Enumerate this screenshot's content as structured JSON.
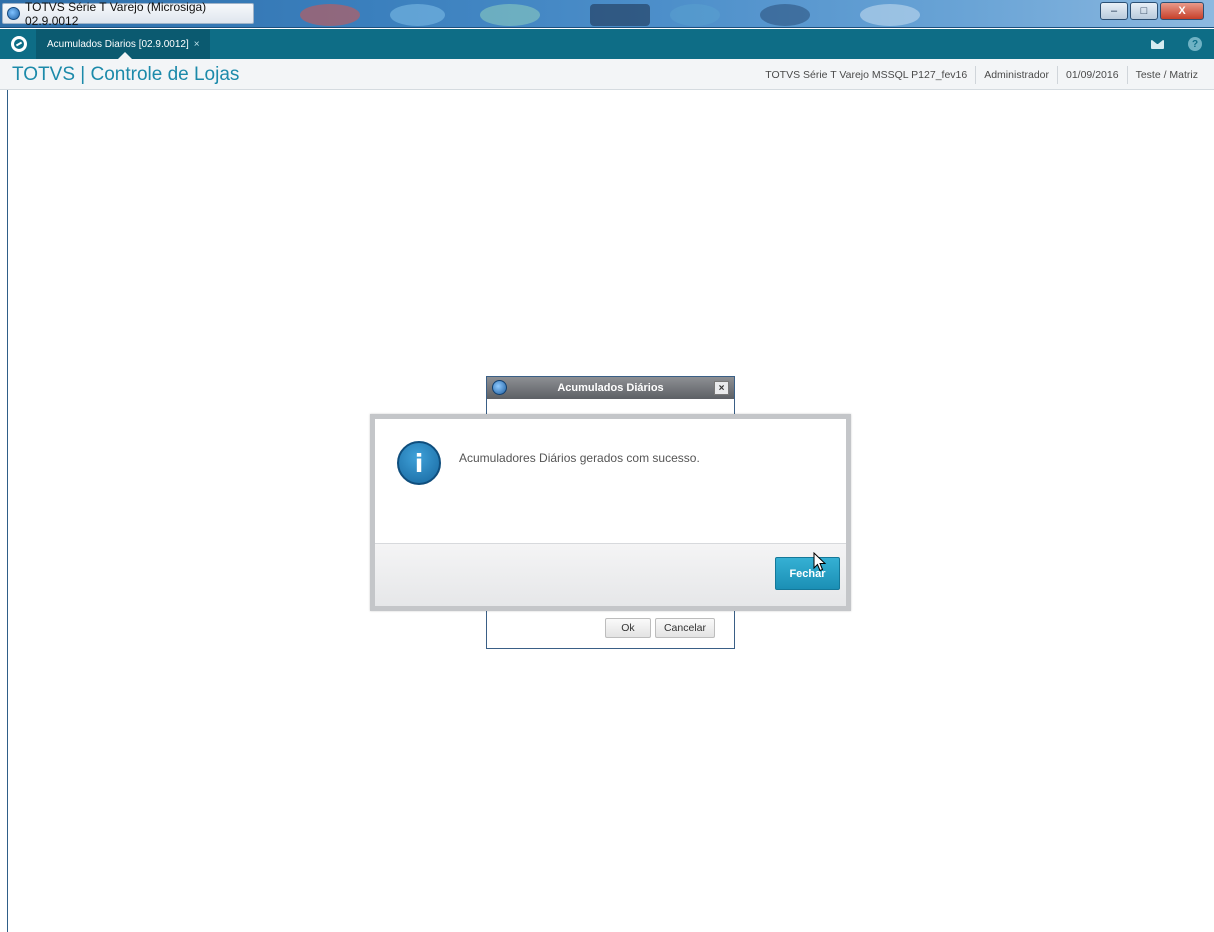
{
  "window": {
    "title": "TOTVS Série T Varejo (Microsiga) 02.9.0012",
    "controls": {
      "minimize": "–",
      "maximize": "□",
      "close": "X"
    }
  },
  "tabbar": {
    "tab_label": "Acumulados Diarios [02.9.0012]",
    "tab_close": "×",
    "help_glyph": "?"
  },
  "header": {
    "app_title": "TOTVS | Controle de Lojas",
    "environment": "TOTVS Série T Varejo MSSQL P127_fev16",
    "user": "Administrador",
    "date": "01/09/2016",
    "branch": "Teste / Matriz"
  },
  "background_dialog": {
    "title": "Acumulados Diários",
    "close_glyph": "×",
    "ok_label": "Ok",
    "cancel_label": "Cancelar"
  },
  "message_dialog": {
    "icon_glyph": "i",
    "message": "Acumuladores Diários gerados com sucesso.",
    "close_label": "Fechar"
  },
  "colors": {
    "tabbar": "#0e6d86",
    "title_accent": "#1c8aaa",
    "primary_button": "#1b8fb5"
  }
}
